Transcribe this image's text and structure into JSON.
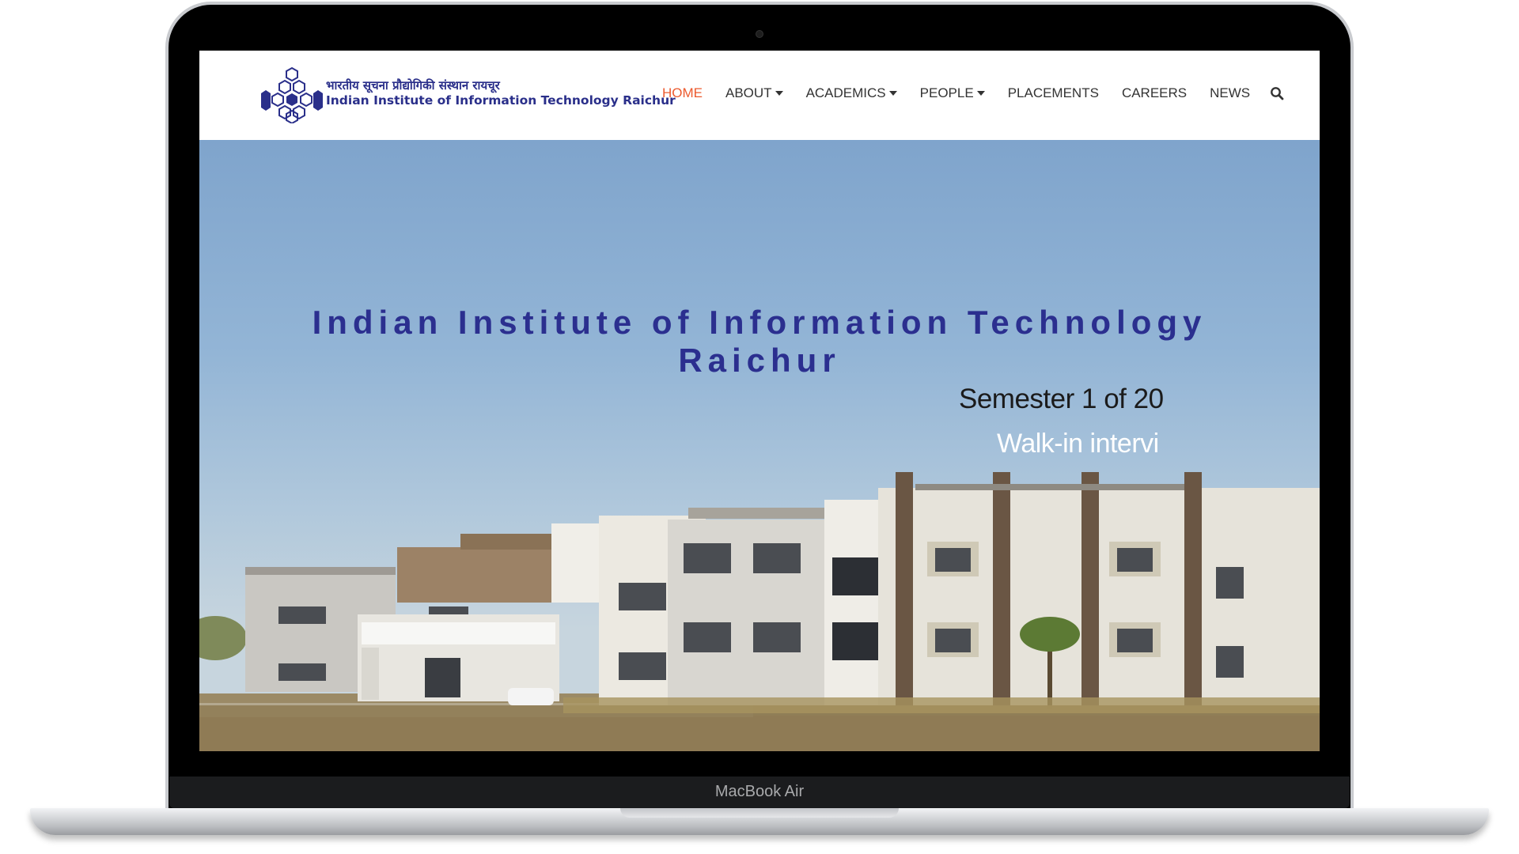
{
  "device": {
    "label": "MacBook Air"
  },
  "brand": {
    "hindi_name": "भारतीय सूचना प्रौद्योगिकी संस्थान रायचूर",
    "english_name": "Indian Institute of Information Technology Raichur"
  },
  "nav": {
    "home": "HOME",
    "about": "ABOUT",
    "academics": "ACADEMICS",
    "people": "PEOPLE",
    "placements": "PLACEMENTS",
    "careers": "CAREERS",
    "news": "NEWS"
  },
  "hero": {
    "title_line1": "Indian Institute of Information Technology",
    "title_line2": "Raichur",
    "subtitle1": "Semester 1 of 20",
    "subtitle2": "Walk-in intervi"
  },
  "colors": {
    "accent_active": "#ec5a2e",
    "brand_blue": "#2a2f8a"
  }
}
